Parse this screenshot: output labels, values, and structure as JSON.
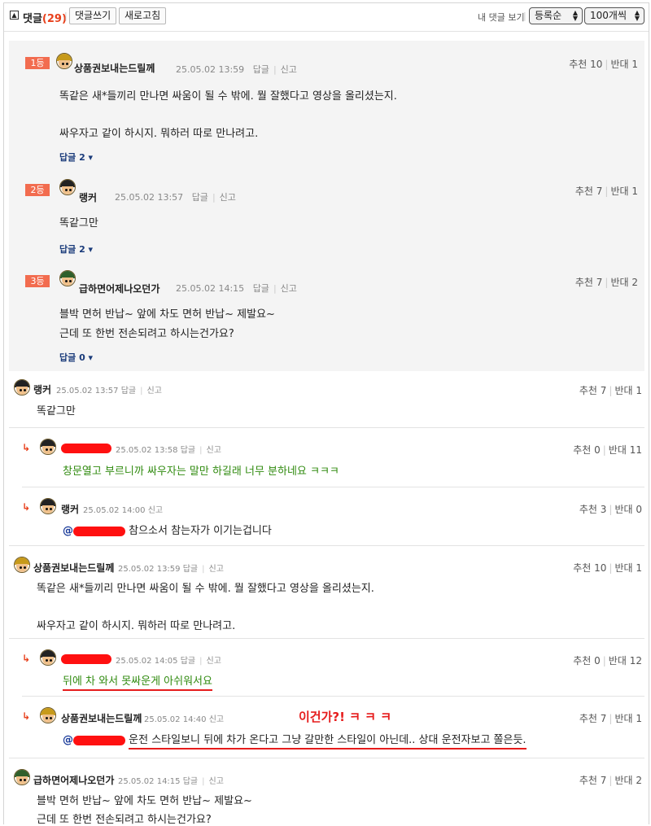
{
  "header": {
    "toggle_glyph": "▲",
    "title": "댓글",
    "count": "(29)",
    "write_button": "댓글쓰기",
    "refresh_button": "새로고침",
    "my_comments": "내 댓글 보기",
    "sort_select": "등록순",
    "page_size_select": "100개씩"
  },
  "labels": {
    "reply": "답글",
    "report": "신고",
    "up": "추천",
    "down": "반대",
    "mention_prefix": "@"
  },
  "best": [
    {
      "rank": "1등",
      "nick": "상품권보내는드릴께",
      "time": "25.05.02 13:59",
      "up": "10",
      "down": "1",
      "line1": "똑같은 새*들끼리 만나면 싸움이 될 수 밖에. 뭘 잘했다고 영상을 올리셨는지.",
      "line2": "싸우자고 같이 하시지. 뭐하러 따로 만나려고.",
      "replies": "답글 2 ▾"
    },
    {
      "rank": "2등",
      "nick": "랭커",
      "time": "25.05.02 13:57",
      "up": "7",
      "down": "1",
      "line1": "똑같그만",
      "replies": "답글 2 ▾"
    },
    {
      "rank": "3등",
      "nick": "급하면어제나오던가",
      "time": "25.05.02 14:15",
      "up": "7",
      "down": "2",
      "line1": "블박 면허 반납~ 앞에 차도 면허 반납~ 제발요~",
      "line2": "근데 또 한번 전손되려고 하시는건가요?",
      "replies": "답글 0 ▾"
    }
  ],
  "comments": [
    {
      "nick": "랭커",
      "time": "25.05.02 13:57",
      "up": "7",
      "down": "1",
      "line1": "똑같그만"
    },
    {
      "time": "25.05.02 13:58",
      "up": "0",
      "down": "11",
      "line1": "창문열고 부르니까 싸우자는 말만 하길래 너무 분하네요 ㅋㅋㅋ"
    },
    {
      "nick": "랭커",
      "time": "25.05.02 14:00",
      "up": "3",
      "down": "0",
      "line1": "참으소서 참는자가 이기는겁니다"
    },
    {
      "nick": "상품권보내는드릴께",
      "time": "25.05.02 13:59",
      "up": "10",
      "down": "1",
      "line1": "똑같은 새*들끼리 만나면 싸움이 될 수 밖에. 뭘 잘했다고 영상을 올리셨는지.",
      "line2": "싸우자고 같이 하시지. 뭐하러 따로 만나려고."
    },
    {
      "time": "25.05.02 14:05",
      "up": "0",
      "down": "12",
      "line1": "뒤에 차 와서 못싸운게 아쉬워서요"
    },
    {
      "nick": "상품권보내는드릴께",
      "time": "25.05.02 14:40",
      "up": "7",
      "down": "1",
      "line1": "운전 스타일보니 뒤에 차가 온다고 그냥 갈만한 스타일이 아닌데.. 상대 운전자보고 쫄은듯.",
      "annotation": "이건가?! ㅋ ㅋ ㅋ"
    },
    {
      "nick": "급하면어제나오던가",
      "time": "25.05.02 14:15",
      "up": "7",
      "down": "2",
      "line1": "블박 면허 반납~ 앞에 차도 면허 반납~ 제발요~",
      "line2": "근데 또 한번 전손되려고 하시는건가요?"
    }
  ]
}
